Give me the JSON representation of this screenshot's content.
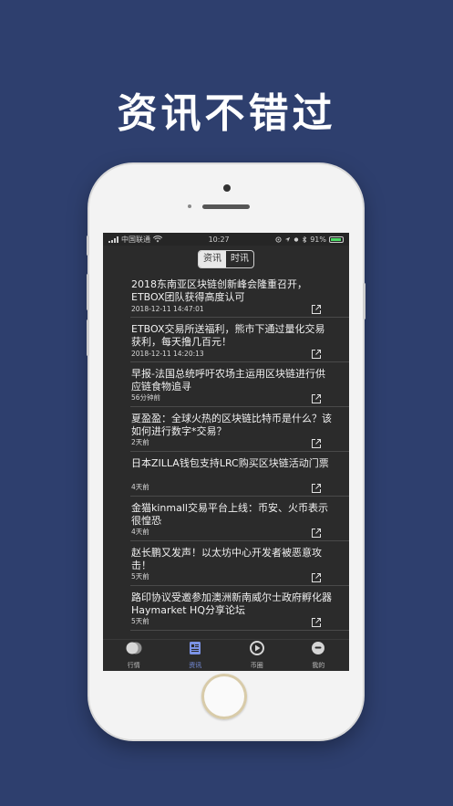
{
  "headline": "资讯不错过",
  "status_bar": {
    "carrier": "中国联通",
    "time": "10:27",
    "battery": "91%"
  },
  "segments": [
    {
      "label": "资讯",
      "active": true
    },
    {
      "label": "时讯",
      "active": false
    }
  ],
  "news": [
    {
      "title": "2018东南亚区块链创新峰会隆重召开，ETBOX团队获得高度认可",
      "time": "2018-12-11 14:47:01"
    },
    {
      "title": "ETBOX交易所送福利，熊市下通过量化交易获利，每天撸几百元！",
      "time": "2018-12-11 14:20:13"
    },
    {
      "title": "早报-法国总统呼吁农场主运用区块链进行供应链食物追寻",
      "time": "56分钟前"
    },
    {
      "title": "夏盈盈：全球火热的区块链比特币是什么？该如何进行数字*交易？",
      "time": "2天前"
    },
    {
      "title": "日本ZILLA钱包支持LRC购买区块链活动门票",
      "time": "4天前"
    },
    {
      "title": "金猫kinmall交易平台上线：币安、火币表示很惶恐",
      "time": "4天前"
    },
    {
      "title": "赵长鹏又发声！以太坊中心开发者被恶意攻击！",
      "time": "5天前"
    },
    {
      "title": "路印协议受邀参加澳洲新南威尔士政府孵化器Haymarket HQ分享论坛",
      "time": "5天前"
    }
  ],
  "tabs": [
    {
      "label": "行情",
      "icon": "market-icon",
      "active": false
    },
    {
      "label": "资讯",
      "icon": "news-icon",
      "active": true
    },
    {
      "label": "币圈",
      "icon": "play-icon",
      "active": false
    },
    {
      "label": "我的",
      "icon": "profile-icon",
      "active": false
    }
  ],
  "colors": {
    "background": "#2e3f6e",
    "screen": "#2b2b2b",
    "accent": "#7b93e6",
    "battery": "#4cd964"
  }
}
